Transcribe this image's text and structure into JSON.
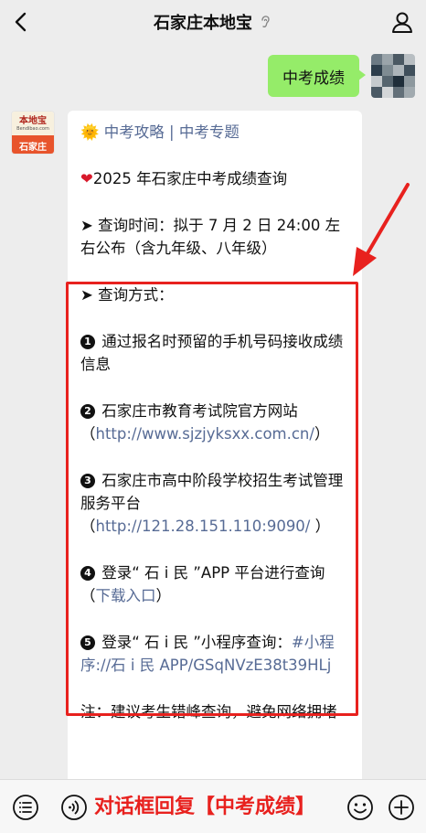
{
  "header": {
    "title": "石家庄本地宝"
  },
  "outgoing": {
    "text": "中考成绩"
  },
  "bot_avatar": {
    "logo_main": "本地宝",
    "logo_sub": "Bendibao.com",
    "logo_city": "石家庄"
  },
  "message": {
    "links_line": {
      "emoji": "🌞",
      "link1": "中考攻略",
      "sep": " | ",
      "link2": "中考专题"
    },
    "headline": {
      "emoji": "❤",
      "text": "2025 年石家庄中考成绩查询"
    },
    "time": {
      "arrow": "➤",
      "text": " 查询时间：拟于 7 月 2 日 24:00 左右公布（含九年级、八年级）"
    },
    "methods_title": {
      "arrow": "➤",
      "text": " 查询方式："
    },
    "method1": {
      "num": "1",
      "text": " 通过报名时预留的手机号码接收成绩信息"
    },
    "method2": {
      "num": "2",
      "text": " 石家庄市教育考试院官方网站",
      "open": "（",
      "link": "http://www.sjzjyksxx.com.cn/",
      "close": "）"
    },
    "method3": {
      "num": "3",
      "text": " 石家庄市高中阶段学校招生考试管理服务平台",
      "open": "（",
      "link": "http://121.28.151.110:9090/",
      "close": " ）"
    },
    "method4": {
      "num": "4",
      "text": " 登录“ 石 i 民 ”APP 平台进行查询",
      "open": "（",
      "link": "下载入口",
      "close": "）"
    },
    "method5": {
      "num": "5",
      "text": " 登录“ 石 i 民 ”小程序查询：",
      "link": "#小程序://石 i 民 APP/GSqNVzE38t39HLj"
    },
    "note": "注：建议考生错峰查询，避免网络拥堵"
  },
  "footer": {
    "hint": "对话框回复【中考成绩】"
  },
  "colors": {
    "accent_green": "#95ec69",
    "link_blue": "#576b95",
    "annotation_red": "#e8211e"
  },
  "icons": [
    "back-arrow-icon",
    "ear-icon",
    "person-icon",
    "menu-list-icon",
    "voice-icon",
    "emoji-icon",
    "plus-icon"
  ]
}
